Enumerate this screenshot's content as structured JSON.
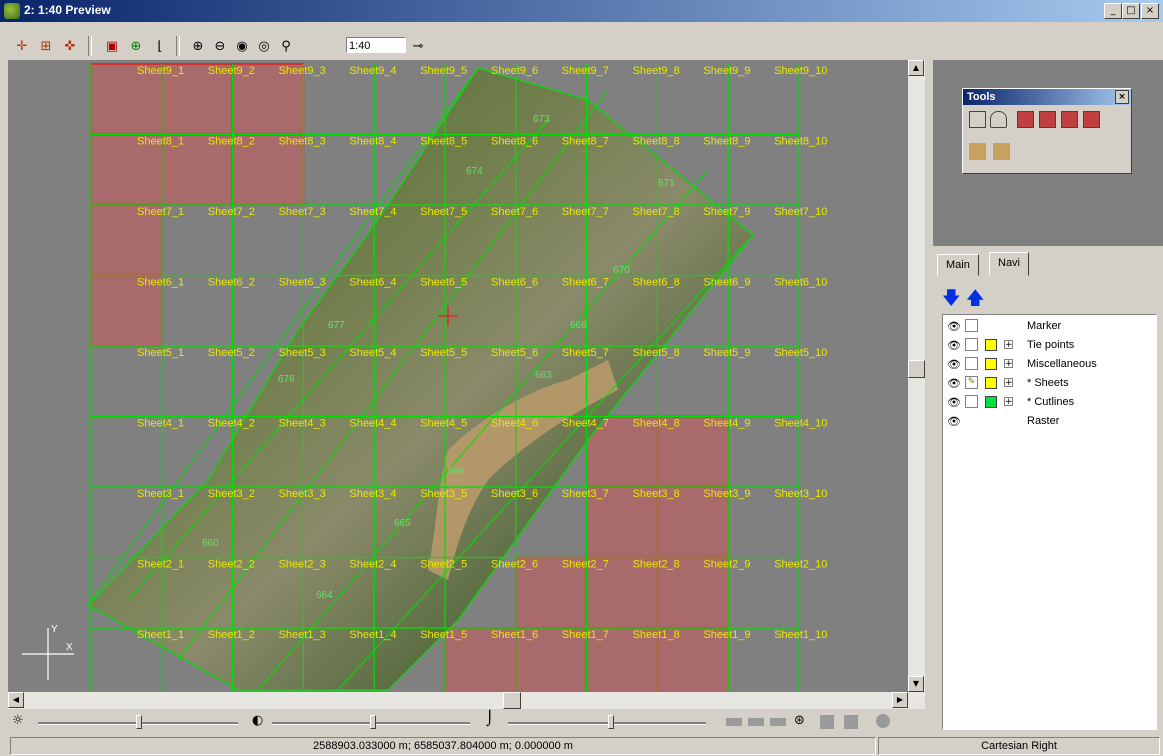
{
  "window": {
    "title": "2: 1:40 Preview",
    "min": "_",
    "max": "□",
    "close": "×"
  },
  "toolbar": {
    "scale_value": "1:40"
  },
  "map": {
    "sheets": [
      "Sheet9_1",
      "Sheet9_2",
      "Sheet9_3",
      "Sheet9_4",
      "Sheet9_5",
      "Sheet9_6",
      "Sheet9_7",
      "Sheet9_8",
      "Sheet9_9",
      "Sheet9_10",
      "Sheet8_1",
      "Sheet8_2",
      "Sheet8_3",
      "Sheet8_4",
      "Sheet8_5",
      "Sheet8_6",
      "Sheet8_7",
      "Sheet8_8",
      "Sheet8_9",
      "Sheet8_10",
      "Sheet7_1",
      "Sheet7_2",
      "Sheet7_3",
      "Sheet7_4",
      "Sheet7_5",
      "Sheet7_6",
      "Sheet7_7",
      "Sheet7_8",
      "Sheet7_9",
      "Sheet7_10",
      "Sheet6_1",
      "Sheet6_2",
      "Sheet6_3",
      "Sheet6_4",
      "Sheet6_5",
      "Sheet6_6",
      "Sheet6_7",
      "Sheet6_8",
      "Sheet6_9",
      "Sheet6_10",
      "Sheet5_1",
      "Sheet5_2",
      "Sheet5_3",
      "Sheet5_4",
      "Sheet5_5",
      "Sheet5_6",
      "Sheet5_7",
      "Sheet5_8",
      "Sheet5_9",
      "Sheet5_10",
      "Sheet4_1",
      "Sheet4_2",
      "Sheet4_3",
      "Sheet4_4",
      "Sheet4_5",
      "Sheet4_6",
      "Sheet4_7",
      "Sheet4_8",
      "Sheet4_9",
      "Sheet4_10",
      "Sheet3_1",
      "Sheet3_2",
      "Sheet3_3",
      "Sheet3_4",
      "Sheet3_5",
      "Sheet3_6",
      "Sheet3_7",
      "Sheet3_8",
      "Sheet3_9",
      "Sheet3_10",
      "Sheet2_1",
      "Sheet2_2",
      "Sheet2_3",
      "Sheet2_4",
      "Sheet2_5",
      "Sheet2_6",
      "Sheet2_7",
      "Sheet2_8",
      "Sheet2_9",
      "Sheet2_10",
      "Sheet1_1",
      "Sheet1_2",
      "Sheet1_3",
      "Sheet1_4",
      "Sheet1_5",
      "Sheet1_6",
      "Sheet1_7",
      "Sheet1_8",
      "Sheet1_9",
      "Sheet1_10"
    ],
    "highlighted": [
      "Sheet9_1",
      "Sheet9_2",
      "Sheet9_3",
      "Sheet8_1",
      "Sheet8_2",
      "Sheet8_3",
      "Sheet7_1",
      "Sheet6_1",
      "Sheet4_8",
      "Sheet4_9",
      "Sheet3_8",
      "Sheet3_9",
      "Sheet2_7",
      "Sheet2_8",
      "Sheet2_9",
      "Sheet1_6",
      "Sheet1_7",
      "Sheet1_8",
      "Sheet1_9"
    ],
    "strip_labels": [
      "673",
      "674",
      "671",
      "670",
      "677",
      "668",
      "676",
      "663",
      "666",
      "665",
      "660",
      "664"
    ],
    "axis_y": "Y",
    "axis_x": "X",
    "colors": {
      "grid": "#00e000",
      "label": "#e8e800",
      "highlight": "#a86a6a",
      "highlight_border": "#e02020"
    }
  },
  "tools": {
    "title": "Tools",
    "close": "×"
  },
  "panel": {
    "tabs": [
      "Main",
      "Navi"
    ],
    "layers": [
      {
        "name": "Marker",
        "swatch": "",
        "expand": ""
      },
      {
        "name": "Tie points",
        "swatch": "#ffff00",
        "expand": "+"
      },
      {
        "name": "Miscellaneous",
        "swatch": "#ffff00",
        "expand": "+"
      },
      {
        "name": "* Sheets",
        "swatch": "#ffff00",
        "expand": "+"
      },
      {
        "name": "* Cutlines",
        "swatch": "#00e040",
        "expand": "+"
      },
      {
        "name": "Raster",
        "swatch": "",
        "expand": ""
      }
    ]
  },
  "status": {
    "coords": "2588903.033000 m; 6585037.804000 m; 0.000000 m",
    "mode": "Cartesian Right"
  }
}
